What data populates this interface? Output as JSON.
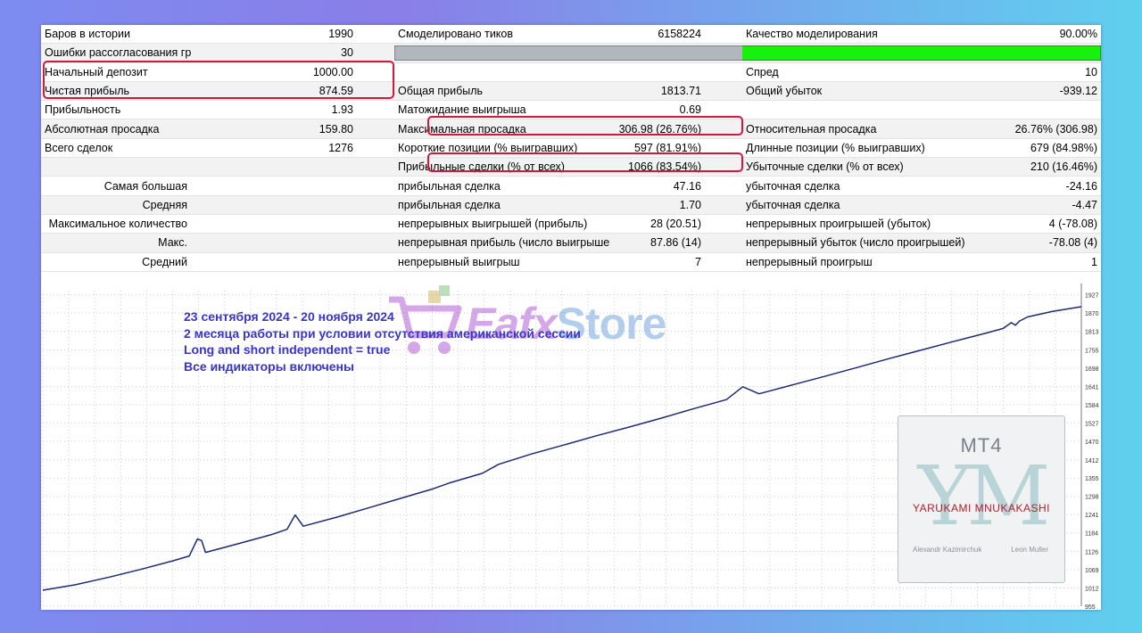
{
  "report": {
    "rows": [
      [
        "Баров в истории",
        "1990",
        "Смоделировано тиков",
        "6158224",
        "Качество моделирования",
        "90.00%"
      ],
      [
        "Ошибки рассогласования графиков",
        "30",
        "",
        "",
        "",
        ""
      ],
      [
        "Начальный депозит",
        "1000.00",
        "",
        "",
        "Спред",
        "10"
      ],
      [
        "Чистая прибыль",
        "874.59",
        "Общая прибыль",
        "1813.71",
        "Общий убыток",
        "-939.12"
      ],
      [
        "Прибыльность",
        "1.93",
        "Матожидание выигрыша",
        "0.69",
        "",
        ""
      ],
      [
        "Абсолютная просадка",
        "159.80",
        "Максимальная просадка",
        "306.98 (26.76%)",
        "Относительная просадка",
        "26.76% (306.98)"
      ],
      [
        "Всего сделок",
        "1276",
        "Короткие позиции (% выигравших)",
        "597 (81.91%)",
        "Длинные позиции (% выигравших)",
        "679 (84.98%)"
      ],
      [
        "",
        "",
        "Прибыльные сделки (% от всех)",
        "1066 (83.54%)",
        "Убыточные сделки (% от всех)",
        "210 (16.46%)"
      ],
      [
        "Самая большая",
        "",
        "прибыльная сделка",
        "47.16",
        "убыточная сделка",
        "-24.16"
      ],
      [
        "Средняя",
        "",
        "прибыльная сделка",
        "1.70",
        "убыточная сделка",
        "-4.47"
      ],
      [
        "Максимальное количество",
        "",
        "непрерывных выигрышей (прибыль)",
        "28 (20.51)",
        "непрерывных проигрышей (убыток)",
        "4 (-78.08)"
      ],
      [
        "Макс.",
        "",
        "непрерывная прибыль (число выигрышей)",
        "87.86 (14)",
        "непрерывный убыток (число проигрышей)",
        "-78.08 (4)"
      ],
      [
        "Средний",
        "",
        "непрерывный выигрыш",
        "7",
        "непрерывный проигрыш",
        "1"
      ]
    ],
    "modeling_quality_fraction": 0.9
  },
  "annotation": {
    "line1": "23 сентября 2024 - 20 ноября 2024",
    "line2": "2 месяца работы при условии отсутствия американской сессии",
    "line3": "Long and short independent = true",
    "line4": "Все индикаторы включены"
  },
  "watermark": {
    "word1": "Eafx",
    "word2": "Store",
    "mt4": "MT4",
    "monogram": "YM",
    "brand": "YARUKAMI MNUKAKASHI",
    "name1": "Alexandr Kazimirchuk",
    "name2": "Leon Muller"
  },
  "colors": {
    "line": "#1e2a72",
    "grid": "#c9ccd3",
    "annotation": "#3a34c7",
    "highlight": "#d3183b",
    "quality_bar": "#16f20e"
  },
  "chart_data": {
    "type": "line",
    "title": "",
    "xlabel": "",
    "ylabel": "",
    "ylim": [
      955,
      1940
    ],
    "y_ticks": [
      955,
      1012,
      1069,
      1126,
      1184,
      1241,
      1298,
      1355,
      1412,
      1470,
      1527,
      1584,
      1641,
      1698,
      1755,
      1813,
      1870,
      1927
    ],
    "grid": true,
    "series": [
      {
        "name": "",
        "x": [
          0,
          40,
          80,
          120,
          160,
          180,
          190,
          195,
          200,
          240,
          280,
          300,
          310,
          320,
          360,
          400,
          440,
          480,
          500,
          540,
          560,
          600,
          640,
          680,
          720,
          760,
          800,
          840,
          860,
          880,
          920,
          960,
          1000,
          1040,
          1080,
          1120,
          1160,
          1180,
          1190,
          1195,
          1200,
          1210,
          1240,
          1276
        ],
        "y": [
          1005,
          1022,
          1045,
          1070,
          1097,
          1112,
          1165,
          1160,
          1123,
          1150,
          1178,
          1195,
          1240,
          1205,
          1232,
          1262,
          1292,
          1322,
          1340,
          1370,
          1398,
          1430,
          1458,
          1487,
          1514,
          1542,
          1572,
          1600,
          1640,
          1618,
          1645,
          1672,
          1700,
          1728,
          1755,
          1782,
          1808,
          1822,
          1840,
          1832,
          1845,
          1858,
          1875,
          1890
        ]
      }
    ],
    "annotations": [
      "23 сентября 2024 - 20 ноября 2024",
      "2 месяца работы при условии отсутствия американской сессии",
      "Long and short independent = true",
      "Все индикаторы включены"
    ]
  }
}
